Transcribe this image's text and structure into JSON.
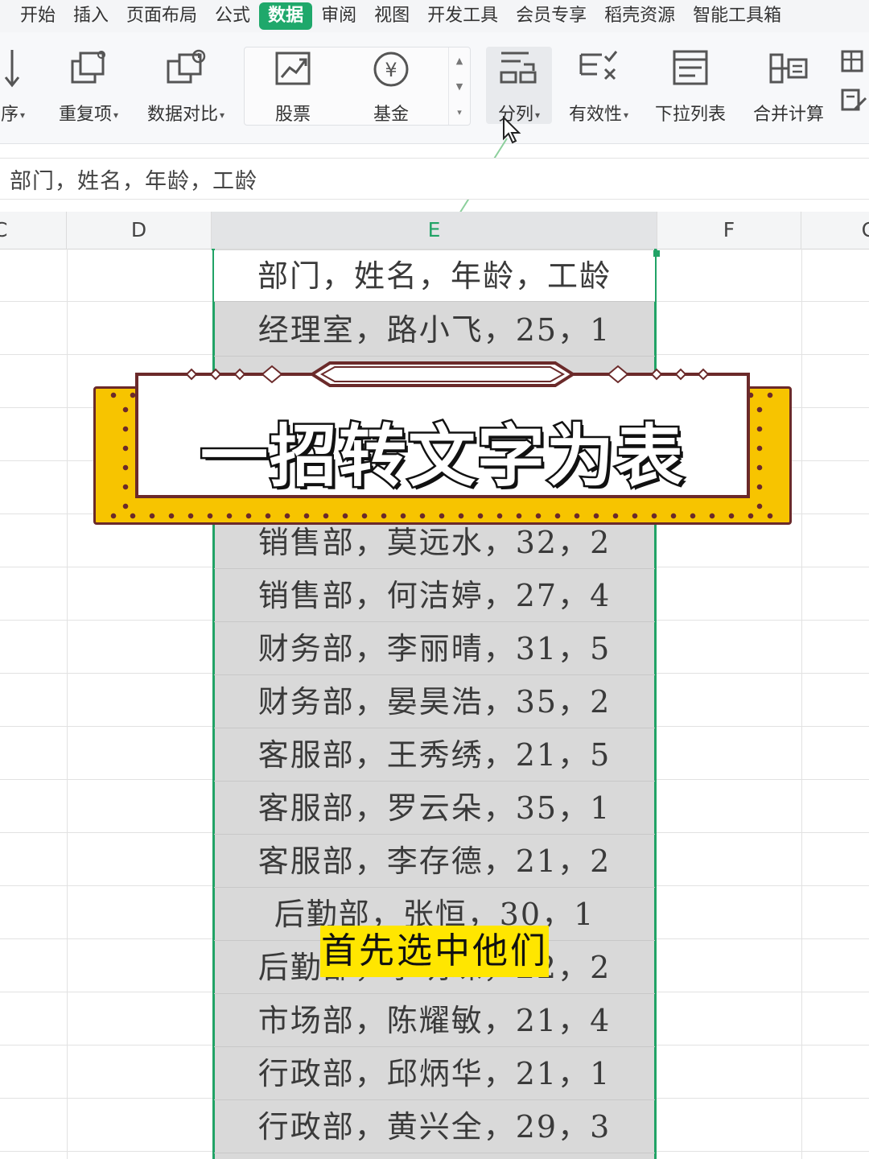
{
  "menu": {
    "tabs": [
      "开始",
      "插入",
      "页面布局",
      "公式",
      "数据",
      "审阅",
      "视图",
      "开发工具",
      "会员专享",
      "稻壳资源",
      "智能工具箱"
    ],
    "active_tab": "数据"
  },
  "ribbon": {
    "sort_partial": "序",
    "duplicates": "重复项",
    "data_compare": "数据对比",
    "stock": "股票",
    "fund": "基金",
    "split_column": "分列",
    "validity": "有效性",
    "dropdown_list": "下拉列表",
    "merge_calc": "合并计算"
  },
  "formula_bar": {
    "content": "部门，姓名，年龄，工龄"
  },
  "sheet": {
    "columns": [
      "C",
      "D",
      "E",
      "F",
      "G"
    ],
    "selected_column": "E",
    "rows": [
      "部门，姓名，年龄，工龄",
      "经理室，路小飞，25，1",
      "",
      "",
      "",
      "销售部，莫远水，32，2",
      "销售部，何洁婷，27，4",
      "财务部，李丽晴，31，5",
      "财务部，晏昊浩，35，2",
      "客服部，王秀绣，21，5",
      "客服部，罗云朵，35，1",
      "客服部，李存德，21，2",
      "后勤部，张恒，30，1",
      "后勤部，李明珠，22，2",
      "市场部，陈耀敏，21，4",
      "行政部，邱炳华，21，1",
      "行政部，黄兴全，29，3"
    ]
  },
  "overlay": {
    "title": "一招转文字为表",
    "caption": "首先选中他们"
  },
  "colors": {
    "accent": "#1fa86b",
    "selection": "#21a366",
    "banner_yellow": "#f7c400",
    "banner_border": "#6b2a2a",
    "caption_bg": "#ffe600"
  }
}
